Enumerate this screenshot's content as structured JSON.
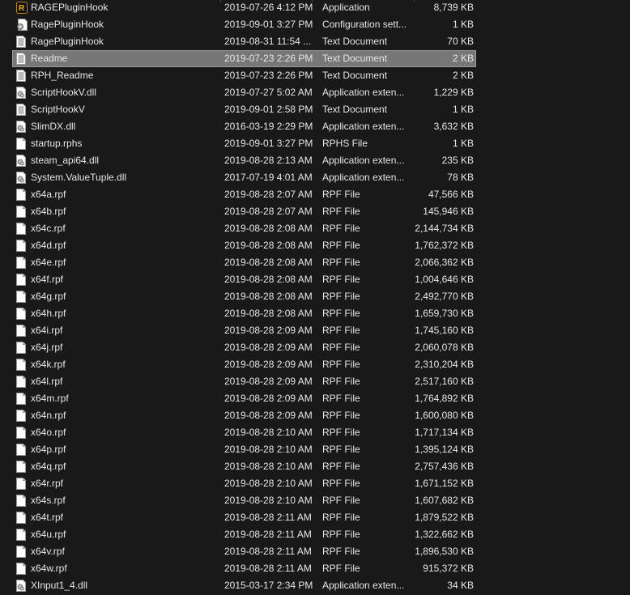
{
  "colors": {
    "background": "#191919",
    "selected": "#777777",
    "text": "#e6e6e6"
  },
  "selected_index": 3,
  "files": [
    {
      "name": "RAGEPluginHook",
      "date": "2019-07-26 4:12 PM",
      "type": "Application",
      "size": "8,739 KB",
      "icon": "rage-app-icon"
    },
    {
      "name": "RagePluginHook",
      "date": "2019-09-01 3:27 PM",
      "type": "Configuration sett...",
      "size": "1 KB",
      "icon": "config-file-icon"
    },
    {
      "name": "RagePluginHook",
      "date": "2019-08-31 11:54 ...",
      "type": "Text Document",
      "size": "70 KB",
      "icon": "text-file-icon"
    },
    {
      "name": "Readme",
      "date": "2019-07-23 2:26 PM",
      "type": "Text Document",
      "size": "2 KB",
      "icon": "text-file-icon"
    },
    {
      "name": "RPH_Readme",
      "date": "2019-07-23 2:26 PM",
      "type": "Text Document",
      "size": "2 KB",
      "icon": "text-file-icon"
    },
    {
      "name": "ScriptHookV.dll",
      "date": "2019-07-27 5:02 AM",
      "type": "Application exten...",
      "size": "1,229 KB",
      "icon": "dll-file-icon"
    },
    {
      "name": "ScriptHookV",
      "date": "2019-09-01 2:58 PM",
      "type": "Text Document",
      "size": "1 KB",
      "icon": "text-file-icon"
    },
    {
      "name": "SlimDX.dll",
      "date": "2016-03-19 2:29 PM",
      "type": "Application exten...",
      "size": "3,632 KB",
      "icon": "dll-file-icon"
    },
    {
      "name": "startup.rphs",
      "date": "2019-09-01 3:27 PM",
      "type": "RPHS File",
      "size": "1 KB",
      "icon": "blank-file-icon"
    },
    {
      "name": "steam_api64.dll",
      "date": "2019-08-28 2:13 AM",
      "type": "Application exten...",
      "size": "235 KB",
      "icon": "dll-file-icon"
    },
    {
      "name": "System.ValueTuple.dll",
      "date": "2017-07-19 4:01 AM",
      "type": "Application exten...",
      "size": "78 KB",
      "icon": "dll-file-icon"
    },
    {
      "name": "x64a.rpf",
      "date": "2019-08-28 2:07 AM",
      "type": "RPF File",
      "size": "47,566 KB",
      "icon": "blank-file-icon"
    },
    {
      "name": "x64b.rpf",
      "date": "2019-08-28 2:07 AM",
      "type": "RPF File",
      "size": "145,946 KB",
      "icon": "blank-file-icon"
    },
    {
      "name": "x64c.rpf",
      "date": "2019-08-28 2:08 AM",
      "type": "RPF File",
      "size": "2,144,734 KB",
      "icon": "blank-file-icon"
    },
    {
      "name": "x64d.rpf",
      "date": "2019-08-28 2:08 AM",
      "type": "RPF File",
      "size": "1,762,372 KB",
      "icon": "blank-file-icon"
    },
    {
      "name": "x64e.rpf",
      "date": "2019-08-28 2:08 AM",
      "type": "RPF File",
      "size": "2,066,362 KB",
      "icon": "blank-file-icon"
    },
    {
      "name": "x64f.rpf",
      "date": "2019-08-28 2:08 AM",
      "type": "RPF File",
      "size": "1,004,646 KB",
      "icon": "blank-file-icon"
    },
    {
      "name": "x64g.rpf",
      "date": "2019-08-28 2:08 AM",
      "type": "RPF File",
      "size": "2,492,770 KB",
      "icon": "blank-file-icon"
    },
    {
      "name": "x64h.rpf",
      "date": "2019-08-28 2:08 AM",
      "type": "RPF File",
      "size": "1,659,730 KB",
      "icon": "blank-file-icon"
    },
    {
      "name": "x64i.rpf",
      "date": "2019-08-28 2:09 AM",
      "type": "RPF File",
      "size": "1,745,160 KB",
      "icon": "blank-file-icon"
    },
    {
      "name": "x64j.rpf",
      "date": "2019-08-28 2:09 AM",
      "type": "RPF File",
      "size": "2,060,078 KB",
      "icon": "blank-file-icon"
    },
    {
      "name": "x64k.rpf",
      "date": "2019-08-28 2:09 AM",
      "type": "RPF File",
      "size": "2,310,204 KB",
      "icon": "blank-file-icon"
    },
    {
      "name": "x64l.rpf",
      "date": "2019-08-28 2:09 AM",
      "type": "RPF File",
      "size": "2,517,160 KB",
      "icon": "blank-file-icon"
    },
    {
      "name": "x64m.rpf",
      "date": "2019-08-28 2:09 AM",
      "type": "RPF File",
      "size": "1,764,892 KB",
      "icon": "blank-file-icon"
    },
    {
      "name": "x64n.rpf",
      "date": "2019-08-28 2:09 AM",
      "type": "RPF File",
      "size": "1,600,080 KB",
      "icon": "blank-file-icon"
    },
    {
      "name": "x64o.rpf",
      "date": "2019-08-28 2:10 AM",
      "type": "RPF File",
      "size": "1,717,134 KB",
      "icon": "blank-file-icon"
    },
    {
      "name": "x64p.rpf",
      "date": "2019-08-28 2:10 AM",
      "type": "RPF File",
      "size": "1,395,124 KB",
      "icon": "blank-file-icon"
    },
    {
      "name": "x64q.rpf",
      "date": "2019-08-28 2:10 AM",
      "type": "RPF File",
      "size": "2,757,436 KB",
      "icon": "blank-file-icon"
    },
    {
      "name": "x64r.rpf",
      "date": "2019-08-28 2:10 AM",
      "type": "RPF File",
      "size": "1,671,152 KB",
      "icon": "blank-file-icon"
    },
    {
      "name": "x64s.rpf",
      "date": "2019-08-28 2:10 AM",
      "type": "RPF File",
      "size": "1,607,682 KB",
      "icon": "blank-file-icon"
    },
    {
      "name": "x64t.rpf",
      "date": "2019-08-28 2:11 AM",
      "type": "RPF File",
      "size": "1,879,522 KB",
      "icon": "blank-file-icon"
    },
    {
      "name": "x64u.rpf",
      "date": "2019-08-28 2:11 AM",
      "type": "RPF File",
      "size": "1,322,662 KB",
      "icon": "blank-file-icon"
    },
    {
      "name": "x64v.rpf",
      "date": "2019-08-28 2:11 AM",
      "type": "RPF File",
      "size": "1,896,530 KB",
      "icon": "blank-file-icon"
    },
    {
      "name": "x64w.rpf",
      "date": "2019-08-28 2:11 AM",
      "type": "RPF File",
      "size": "915,372 KB",
      "icon": "blank-file-icon"
    },
    {
      "name": "XInput1_4.dll",
      "date": "2015-03-17 2:34 PM",
      "type": "Application exten...",
      "size": "34 KB",
      "icon": "dll-file-icon"
    }
  ]
}
